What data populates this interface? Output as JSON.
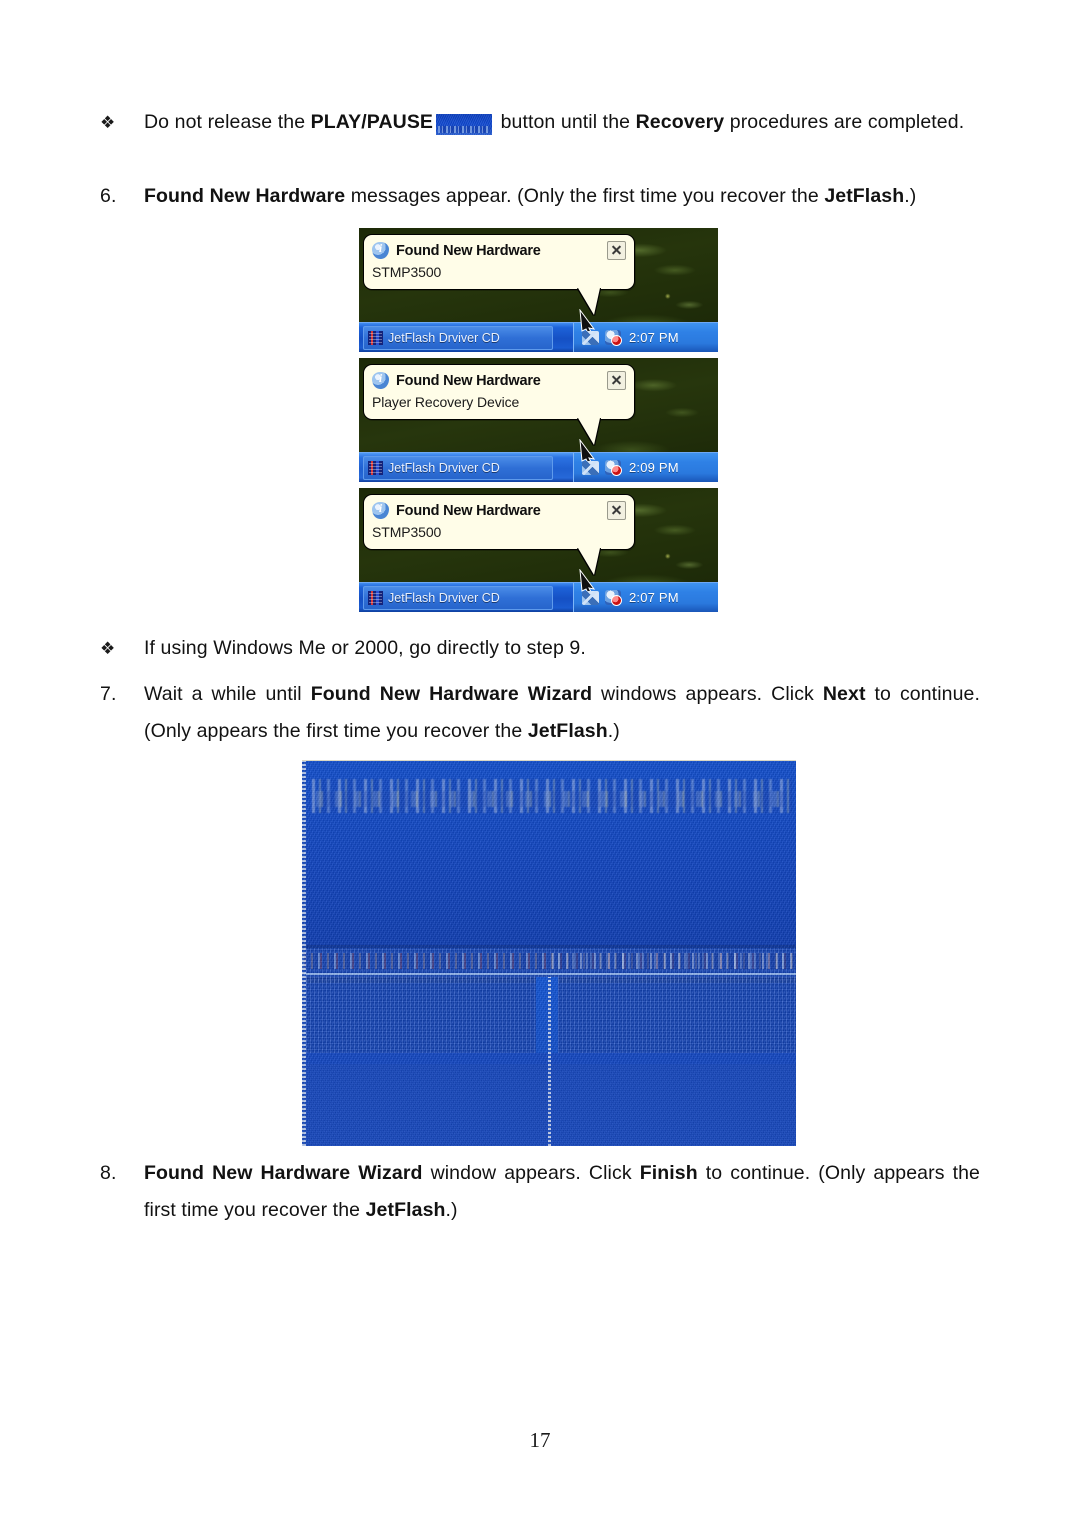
{
  "document": {
    "page_number": "17"
  },
  "bullet_1": {
    "marker": "❖",
    "text_before": "Do not release the ",
    "bold_1": "PLAY/PAUSE",
    "image_name": "play-pause-button-image",
    "text_middle": " button until the ",
    "bold_2": "Recovery",
    "text_after": " procedures are completed."
  },
  "step_6": {
    "marker": "6.",
    "bold_1": "Found New Hardware",
    "text_1": " messages appear. (Only the first time you recover the ",
    "bold_2": "JetFlash",
    "text_2": ".)"
  },
  "balloons": [
    {
      "title": "Found New Hardware",
      "device": "STMP3500",
      "taskbar_label": "JetFlash Drviver CD",
      "clock": "2:07 PM",
      "info_icon": "info-icon",
      "close_icon": "close-icon",
      "tray_icons": [
        "network-icon",
        "security-shield-icon"
      ]
    },
    {
      "title": "Found New Hardware",
      "device": "Player Recovery Device",
      "taskbar_label": "JetFlash Drviver CD",
      "clock": "2:09 PM",
      "info_icon": "info-icon",
      "close_icon": "close-icon",
      "tray_icons": [
        "network-icon",
        "security-shield-icon"
      ]
    },
    {
      "title": "Found New Hardware",
      "device": "STMP3500",
      "taskbar_label": "JetFlash Drviver CD",
      "clock": "2:07 PM",
      "info_icon": "info-icon",
      "close_icon": "close-icon",
      "tray_icons": [
        "network-icon",
        "security-shield-icon"
      ]
    }
  ],
  "bullet_2": {
    "marker": "❖",
    "text": "If using Windows Me or 2000, go directly to step 9."
  },
  "step_7": {
    "marker": "7.",
    "text_1": "Wait a while until ",
    "bold_1": "Found New Hardware Wizard",
    "text_2": " windows appears. Click ",
    "bold_2": "Next",
    "text_3": " to continue. (Only appears the first time you recover the ",
    "bold_3": "JetFlash",
    "text_4": ".)"
  },
  "wizard_image": {
    "caption": "corrupted-found-new-hardware-wizard-screenshot",
    "background_color": "#1448c4"
  },
  "step_8": {
    "marker": "8.",
    "bold_1": "Found New Hardware Wizard",
    "text_1": " window appears. Click ",
    "bold_2": "Finish",
    "text_2": " to continue. (Only appears the first time you recover the ",
    "bold_3": "JetFlash",
    "text_3": ".)"
  }
}
